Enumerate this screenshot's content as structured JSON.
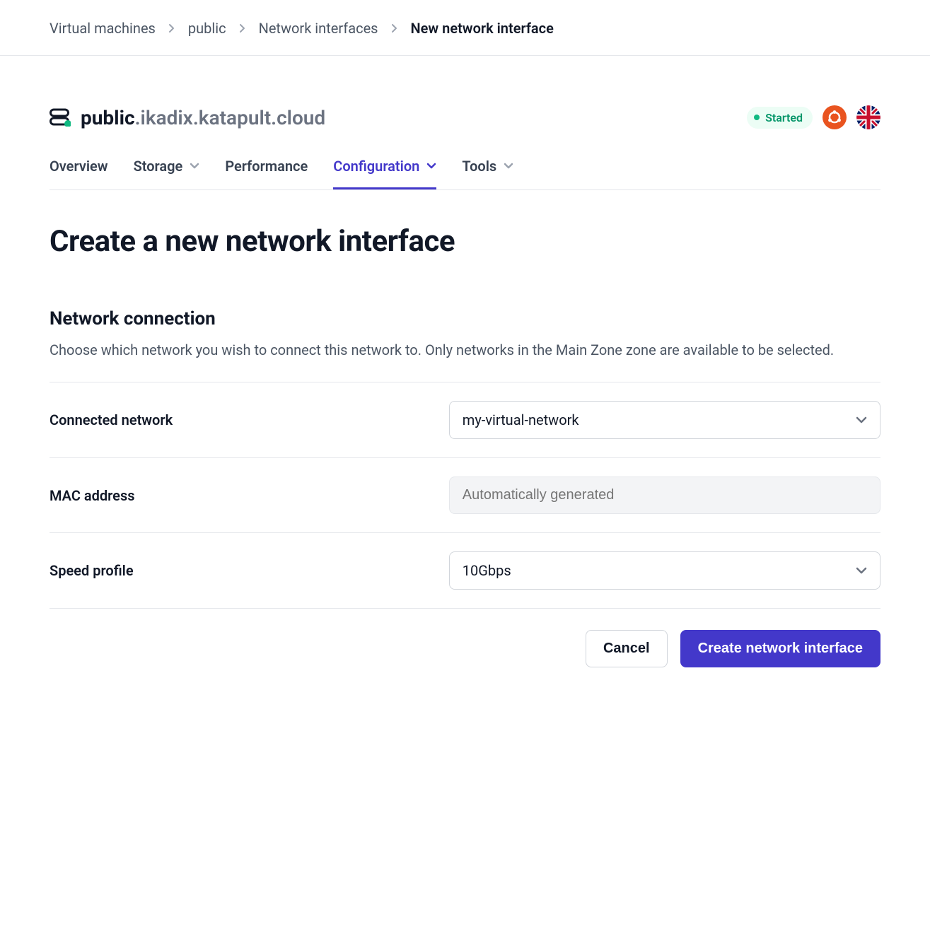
{
  "breadcrumb": {
    "items": [
      {
        "label": "Virtual machines"
      },
      {
        "label": "public"
      },
      {
        "label": "Network interfaces"
      }
    ],
    "current": "New network interface"
  },
  "header": {
    "hostname_primary": "public",
    "hostname_rest": ".ikadix.katapult.cloud",
    "status": "Started"
  },
  "tabs": [
    {
      "label": "Overview",
      "has_chevron": false,
      "active": false
    },
    {
      "label": "Storage",
      "has_chevron": true,
      "active": false
    },
    {
      "label": "Performance",
      "has_chevron": false,
      "active": false
    },
    {
      "label": "Configuration",
      "has_chevron": true,
      "active": true
    },
    {
      "label": "Tools",
      "has_chevron": true,
      "active": false
    }
  ],
  "page": {
    "title": "Create a new network interface",
    "section_title": "Network connection",
    "section_desc": "Choose which network you wish to connect this network to. Only networks in the Main Zone zone are available to be selected."
  },
  "form": {
    "connected_network": {
      "label": "Connected network",
      "value": "my-virtual-network"
    },
    "mac_address": {
      "label": "MAC address",
      "placeholder": "Automatically generated",
      "value": ""
    },
    "speed_profile": {
      "label": "Speed profile",
      "value": "10Gbps"
    }
  },
  "actions": {
    "cancel": "Cancel",
    "submit": "Create network interface"
  }
}
